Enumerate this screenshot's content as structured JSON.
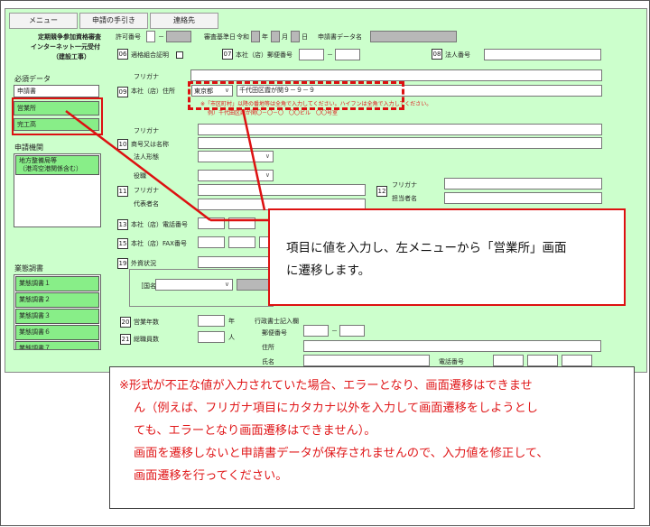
{
  "tabs": [
    "メニュー",
    "申請の手引き",
    "連絡先"
  ],
  "header": {
    "title_line1": "定期競争参加資格審査",
    "title_line2": "インターネット一元受付",
    "title_line3": "（建設工事）",
    "permit_no_label": "許可番号",
    "permit_no_sep": "－",
    "review_date_label": "審査基準日",
    "era": "令和",
    "year_unit": "年",
    "month_unit": "月",
    "day_unit": "日",
    "data_name_label": "申請書データ名",
    "item06": "06",
    "item06_label": "適格組合証明",
    "item07": "07",
    "item07_label": "本社（店）郵便番号",
    "postal_sep": "－",
    "item08": "08",
    "item08_label": "法人番号"
  },
  "sidebar": {
    "required_title": "必須データ",
    "required": [
      "申請書",
      "営業所",
      "完工高"
    ],
    "org_title": "申請機関",
    "org_item_line1": "地方整備局等",
    "org_item_line2": "（港湾空港関係含む）",
    "survey_title": "業態調書",
    "survey_items": [
      "業態調書１",
      "業態調書２",
      "業態調書３",
      "業態調書６",
      "業態調書７"
    ]
  },
  "form": {
    "furigana": "フリガナ",
    "item09": "09",
    "item09_label": "本社（店）住所",
    "prefecture": "東京都",
    "address": "千代田区霞が関９－９－９",
    "note1": "※「市区町村」以降の番地等は全角で入力してください。ハイフンは全角で入力してください。",
    "note2": "例）千代田区霞が関〇－〇－〇　〇〇ビル　〇〇号室",
    "furigana2": "フリガナ",
    "item10": "10",
    "item10_label": "商号又は名称",
    "corp_form": "法人形態",
    "position": "役職",
    "item11": "11",
    "furigana3": "フリガナ",
    "rep_name": "代表者名",
    "item12": "12",
    "item12_furigana": "フリガナ",
    "item12_label": "担当者名",
    "item13": "13",
    "item13_label": "本社（店）電話番号",
    "item15": "15",
    "item15_label": "本社（店）FAX番号",
    "item19": "19",
    "item19_label": "外資状況",
    "country_label": "［国名",
    "item20": "20",
    "item20_label": "営業年数",
    "year_unit": "年",
    "item21": "21",
    "item21_label": "総職員数",
    "person_unit": "人",
    "scrivener_title": "行政書士記入欄",
    "scrivener_postal": "郵便番号",
    "scrivener_address": "住所",
    "scrivener_name": "氏名",
    "scrivener_phone": "電話番号",
    "scrivener_sep": "－"
  },
  "callout1": {
    "line1": "項目に値を入力し、左メニューから「営業所」画面",
    "line2": "に遷移します。"
  },
  "callout2": {
    "line1": "※形式が不正な値が入力されていた場合、エラーとなり、画面遷移はできませ",
    "line2": "ん（例えば、フリガナ項目にカタカナ以外を入力して画面遷移をしようとし",
    "line3": "ても、エラーとなり画面遷移はできません）。",
    "line4": "画面を遷移しないと申請書データが保存されませんので、入力値を修正して、",
    "line5": "画面遷移を行ってください。"
  },
  "colors": {
    "app_bg": "#ccffcc",
    "menu_green": "#88ee88",
    "alert_red": "#dd1111"
  }
}
